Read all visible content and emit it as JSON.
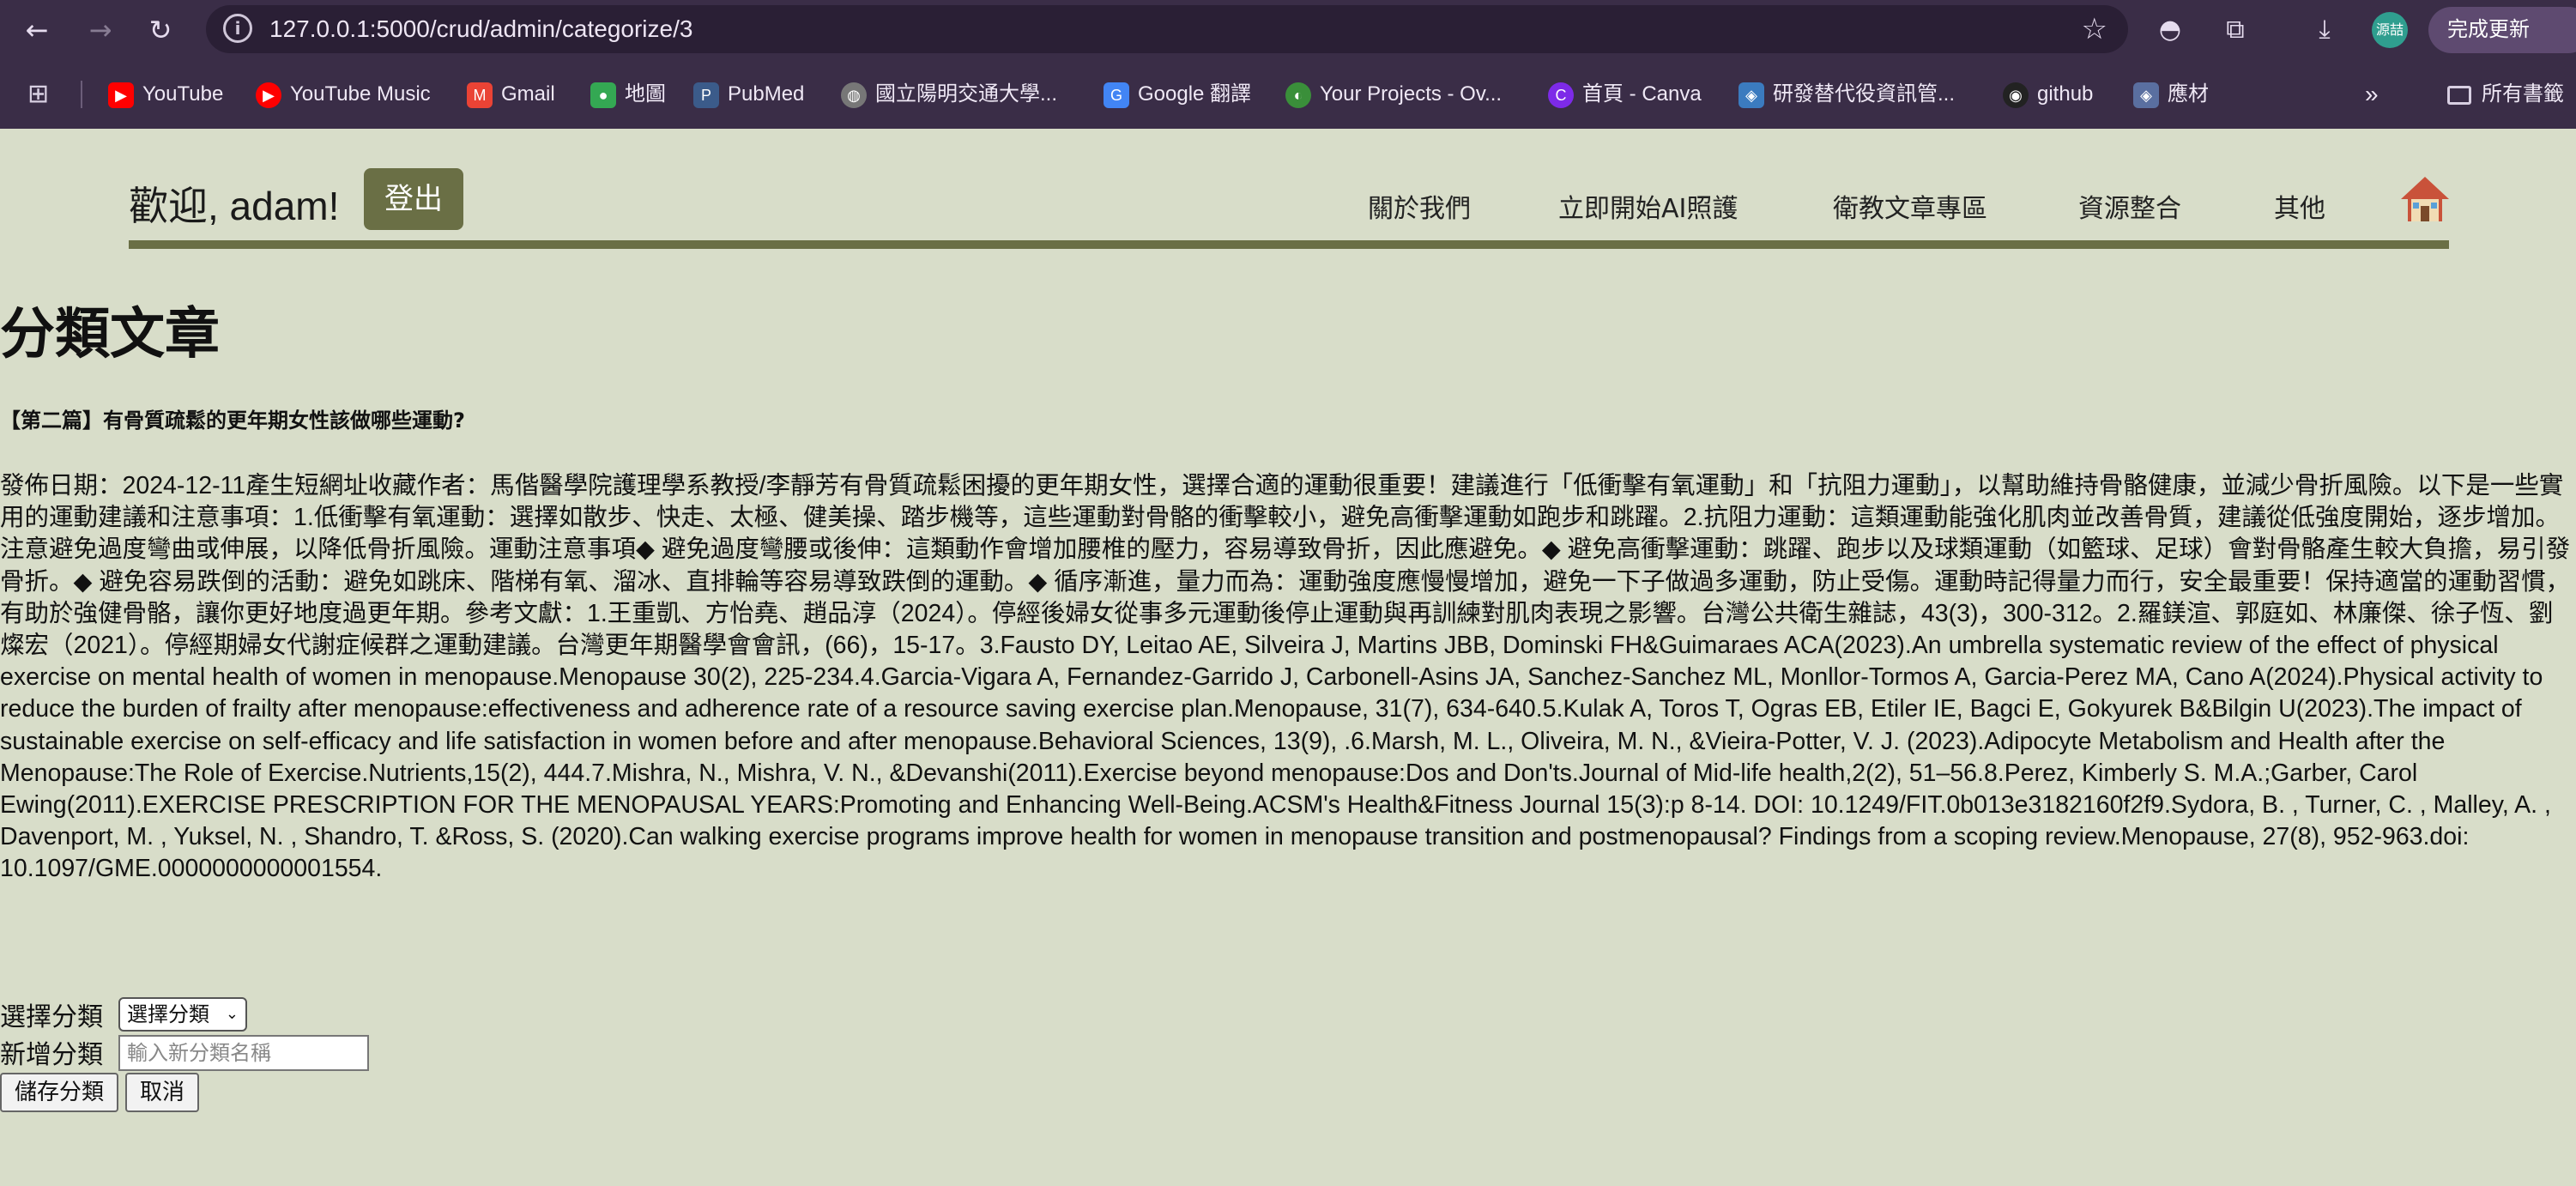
{
  "browser": {
    "url": "127.0.0.1:5000/crud/admin/categorize/3",
    "update_label": "完成更新",
    "avatar_text": "源喆",
    "bookmarks": [
      {
        "label": "YouTube",
        "color": "#ff0000",
        "icon": "youtube-icon"
      },
      {
        "label": "YouTube Music",
        "color": "#ff0000",
        "icon": "youtube-music-icon"
      },
      {
        "label": "Gmail",
        "color": "#ea4335",
        "icon": "gmail-icon"
      },
      {
        "label": "地圖",
        "color": "#34a853",
        "icon": "maps-icon"
      },
      {
        "label": "PubMed",
        "color": "#3b5b8a",
        "icon": "pubmed-icon"
      },
      {
        "label": "國立陽明交通大學...",
        "color": "#777777",
        "icon": "globe-icon"
      },
      {
        "label": "Google 翻譯",
        "color": "#4285f4",
        "icon": "translate-icon"
      },
      {
        "label": "Your Projects - Ov...",
        "color": "#3a8f3a",
        "icon": "overleaf-icon"
      },
      {
        "label": "首頁 - Canva",
        "color": "#7d2ae8",
        "icon": "canva-icon"
      },
      {
        "label": "研發替代役資訊管...",
        "color": "#3b7bbf",
        "icon": "site-icon"
      },
      {
        "label": "github",
        "color": "#222222",
        "icon": "github-icon"
      },
      {
        "label": "應材",
        "color": "#5a6fa0",
        "icon": "site-icon"
      }
    ],
    "all_bookmarks": "所有書籤"
  },
  "header": {
    "welcome": "歡迎, adam!",
    "logout": "登出",
    "menu": [
      "關於我們",
      "立即開始AI照護",
      "衛教文章專區",
      "資源整合",
      "其他"
    ]
  },
  "page": {
    "title": "分類文章",
    "article_title": "【第二篇】有骨質疏鬆的更年期女性該做哪些運動?",
    "article_body": "發佈日期：2024-12-11產生短網址收藏作者：馬偕醫學院護理學系教授/李靜芳有骨質疏鬆困擾的更年期女性，選擇合適的運動很重要！建議進行「低衝擊有氧運動」和「抗阻力運動」，以幫助維持骨骼健康，並減少骨折風險。以下是一些實用的運動建議和注意事項：1.低衝擊有氧運動：選擇如散步、快走、太極、健美操、踏步機等，這些運動對骨骼的衝擊較小，避免高衝擊運動如跑步和跳躍。2.抗阻力運動：這類運動能強化肌肉並改善骨質，建議從低強度開始，逐步增加。注意避免過度彎曲或伸展，以降低骨折風險。運動注意事項◆ 避免過度彎腰或後伸：這類動作會增加腰椎的壓力，容易導致骨折，因此應避免。◆ 避免高衝擊運動：跳躍、跑步以及球類運動（如籃球、足球）會對骨骼產生較大負擔，易引發骨折。◆ 避免容易跌倒的活動：避免如跳床、階梯有氧、溜冰、直排輪等容易導致跌倒的運動。◆ 循序漸進，量力而為：運動強度應慢慢增加，避免一下子做過多運動，防止受傷。運動時記得量力而行，安全最重要！保持適當的運動習慣，有助於強健骨骼，讓你更好地度過更年期。參考文獻：1.王重凱、方怡堯、趙品淳（2024）。停經後婦女從事多元運動後停止運動與再訓練對肌肉表現之影響。台灣公共衛生雜誌，43(3)，300-312。2.羅鎂渲、郭庭如、林廉傑、徐子恆、劉燦宏（2021）。停經期婦女代謝症候群之運動建議。台灣更年期醫學會會訊，(66)，15-17。3.Fausto DY, Leitao AE, Silveira J, Martins JBB, Dominski FH&Guimaraes ACA(2023).An umbrella systematic review of the effect of physical exercise on mental health of women in menopause.Menopause 30(2), 225-234.4.Garcia-Vigara A, Fernandez-Garrido J, Carbonell-Asins JA, Sanchez-Sanchez ML, Monllor-Tormos A, Garcia-Perez MA, Cano A(2024).Physical activity to reduce the burden of frailty after menopause:effectiveness and adherence rate of a resource saving exercise plan.Menopause, 31(7), 634-640.5.Kulak A, Toros T, Ogras EB, Etiler IE, Bagci E, Gokyurek B&Bilgin U(2023).The impact of sustainable exercise on self-efficacy and life satisfaction in women before and after menopause.Behavioral Sciences, 13(9), .6.Marsh, M. L., Oliveira, M. N., &Vieira-Potter, V. J. (2023).Adipocyte Metabolism and Health after the Menopause:The Role of Exercise.Nutrients,15(2), 444.7.Mishra, N., Mishra, V. N., &Devanshi(2011).Exercise beyond menopause:Dos and Don'ts.Journal of Mid-life health,2(2), 51–56.8.Perez, Kimberly S. M.A.;Garber, Carol Ewing(2011).EXERCISE PRESCRIPTION FOR THE MENOPAUSAL YEARS:Promoting and Enhancing Well-Being.ACSM's Health&Fitness Journal 15(3):p 8-14. DOI: 10.1249/FIT.0b013e3182160f2f9.Sydora, B. , Turner, C. , Malley, A. , Davenport, M. , Yuksel, N. , Shandro, T. &Ross, S. (2020).Can walking exercise programs improve health for women in menopause transition and postmenopausal? Findings from a scoping review.Menopause, 27(8), 952-963.doi: 10.1097/GME.0000000000001554."
  },
  "form": {
    "select_label": "選擇分類",
    "select_value": "選擇分類",
    "new_label": "新增分類",
    "new_placeholder": "輸入新分類名稱",
    "save": "儲存分類",
    "cancel": "取消"
  }
}
